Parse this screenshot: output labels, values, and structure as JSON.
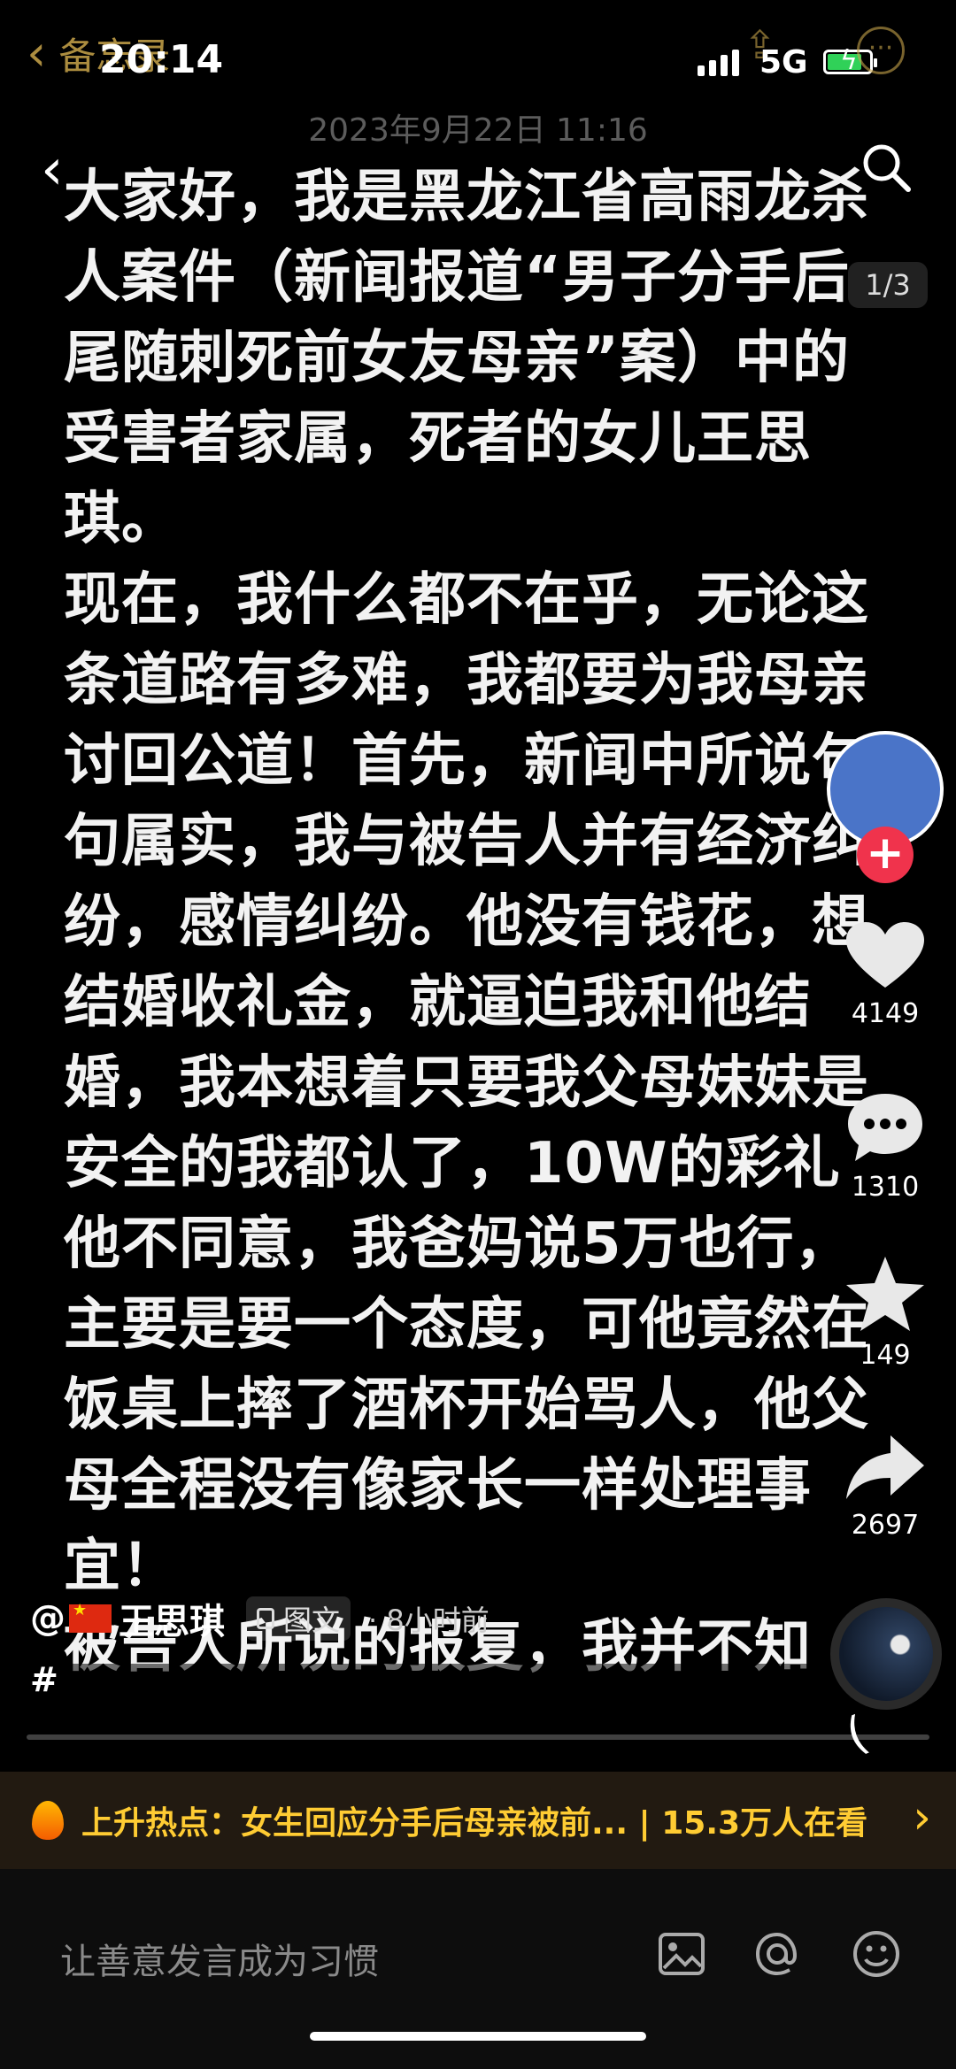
{
  "status_bar": {
    "notes_back_label": "备忘录",
    "time": "20:14",
    "network": "5G",
    "battery_color": "#30d158"
  },
  "note": {
    "date": "2023年9月22日 11:16"
  },
  "nav": {
    "back_icon": "chevron-left-icon",
    "search_icon": "search-icon",
    "page_indicator": "1/3"
  },
  "body_paragraphs": [
    "大家好，我是黑龙江省高雨龙杀人案件（新闻报道“男子分手后尾随刺死前女友母亲”案）中的受害者家属，死者的女儿王思琪。",
    "现在，我什么都不在乎，无论这条道路有多难，我都要为我母亲讨回公道！首先，新闻中所说句句属实，我与被告人并有经济纠纷，感情纠纷。他没有钱花，想结婚收礼金，就逼迫我和他结婚，我本想着只要我父母妹妹是安全的我都认了，10W的彩礼他不同意，我爸妈说5万也行，主要是要一个态度，可他竟然在饭桌上摔了酒杯开始骂人，他父母全程没有像家长一样处理事宜！",
    "被告人所说的报复，我并不知"
  ],
  "rail": {
    "follow_label": "+",
    "like_count": "4149",
    "comment_count": "1310",
    "favorite_count": "149",
    "share_count": "2697"
  },
  "author": {
    "at": "@",
    "name": "王思琪",
    "type_tag": "图文",
    "time_ago": "· 8小时前",
    "hashtag": "#"
  },
  "hot_banner": {
    "text": "上升热点：女生回应分手后母亲被前... | 15.3万人在看",
    "color": "#ffcc33"
  },
  "comment_bar": {
    "placeholder": "让善意发言成为习惯",
    "icons": [
      "image-icon",
      "at-icon",
      "emoji-icon"
    ]
  }
}
